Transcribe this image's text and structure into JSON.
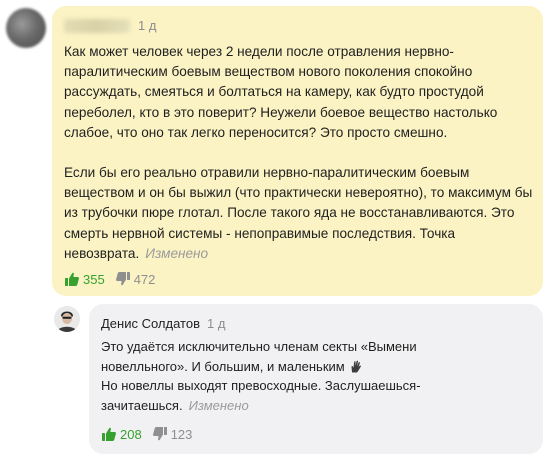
{
  "comment": {
    "author_name": "",
    "time": "1 д",
    "paragraphs": [
      "Как может человек через 2 недели после отравления нервно-паралитическим боевым веществом нового поколения спокойно рассуждать, смеяться и болтаться на камеру, как будто простудой переболел, кто в это поверит? Неужели боевое вещество настолько слабое, что оно так легко переносится? Это просто смешно.",
      "Если бы его реально отравили нервно-паралитическим боевым веществом и он бы выжил (что практически невероятно), то максимум бы из трубочки пюре глотал. После такого яда не восстанавливаются. Это смерть нервной системы - непоправимые последствия. Точка невозврата."
    ],
    "edited_label": "Изменено",
    "likes": "355",
    "dislikes": "472"
  },
  "reply": {
    "author_name": "Денис Солдатов",
    "time": "1 д",
    "lines": [
      "Это удаётся исключительно членам секты «Вымени новелльного». И большим, и маленьким",
      "Но новеллы выходят превосходные. Заслушаешься-зачитаешься."
    ],
    "edited_label": "Изменено",
    "likes": "208",
    "dislikes": "123"
  },
  "colors": {
    "main_bubble": "#fbf3c4",
    "reply_bubble": "#f1f1f3",
    "like": "#36a12f",
    "dislike": "#8f8f8f",
    "meta": "#8c8c8c"
  },
  "icons": [
    "thumbs-up-icon",
    "thumbs-down-icon",
    "hand-emoji-icon",
    "avatar"
  ]
}
